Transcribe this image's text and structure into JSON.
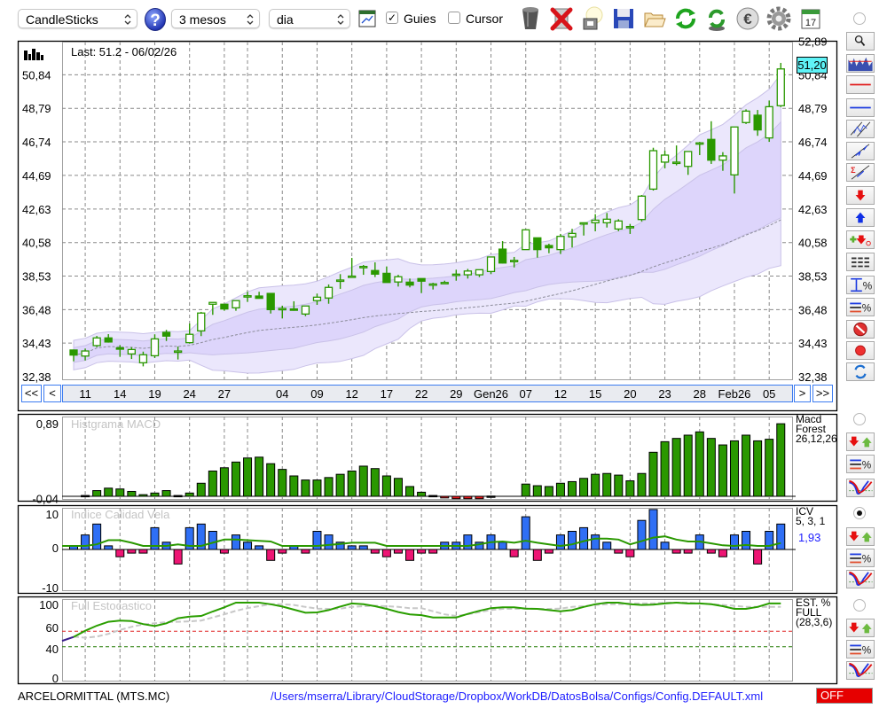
{
  "toolbar": {
    "chart_type": "CandleSticks",
    "period": "3 mesos",
    "interval": "dia",
    "guies_label": "Guies",
    "guies_checked": true,
    "cursor_label": "Cursor",
    "cursor_checked": false,
    "check_mark": "✓",
    "icons": [
      "help-icon",
      "chart-settings-icon",
      "trash-icon",
      "delete-icon",
      "lamp-icon",
      "save-icon",
      "folder-open-icon",
      "refresh-icon",
      "sync-icon",
      "euro-icon",
      "gear-icon",
      "calendar-icon"
    ],
    "calendar_day": "17"
  },
  "price_panel": {
    "last_label": "Last: 51.2 - 06/02/26",
    "last_price_badge": "51,20",
    "nav": {
      "first": "<<",
      "prev": "<",
      "next": ">",
      "last": ">>"
    }
  },
  "side_tools": [
    "zoom-icon",
    "chart-thumbnail-icon",
    "horizontal-red-line-icon",
    "horizontal-blue-line-icon",
    "channel-icon",
    "trendline-icon",
    "sigma-trendline-icon",
    "sell-arrow-icon",
    "buy-arrow-icon",
    "add-order-icon",
    "dashed-lines-icon",
    "percent-range-icon",
    "percent-lines-icon",
    "no-entry-icon",
    "record-icon",
    "swap-icon"
  ],
  "indicators": {
    "macd": {
      "label": "Macd\nForest\n26,12,26",
      "selected": false
    },
    "icv": {
      "label": "ICV\n5, 3, 1",
      "value": "1,93",
      "selected": true
    },
    "stoch": {
      "label": "EST. %\nFULL\n(28,3,6)",
      "selected": false
    }
  },
  "footer": {
    "symbol": "ARCELORMITTAL (MTS.MC)",
    "config_path": "/Users/mserra/Library/CloudStorage/Dropbox/WorkDB/DatosBolsa/Configs/Config.DEFAULT.xml",
    "status": "OFF"
  },
  "colors": {
    "candle": "#2a9800",
    "band_outer": "#ebe7fc",
    "band_inner": "#ddd5fb",
    "macd_pos": "#2a9800",
    "macd_neg": "#e8191c",
    "icv_pos": "#2f6ff5",
    "icv_neg": "#ee1574",
    "icv_signal": "#2a9800",
    "stoch_k": "#2a9e00",
    "stoch_d": "#c8c8c8",
    "badge": "#5ff3f7",
    "off": "#e60000",
    "path": "#1d1dff"
  },
  "chart_data": [
    {
      "type": "candlestick",
      "y_ticks": [
        32.38,
        34.43,
        36.48,
        38.53,
        40.58,
        42.63,
        44.69,
        46.74,
        48.79,
        50.84,
        52.89
      ],
      "ylim": [
        32.38,
        52.89
      ],
      "grid": true,
      "x_labels": [
        {
          "label": "11",
          "index": 1
        },
        {
          "label": "14",
          "index": 4
        },
        {
          "label": "19",
          "index": 7
        },
        {
          "label": "24",
          "index": 10
        },
        {
          "label": "27",
          "index": 13
        },
        {
          "label": "",
          "index": 15
        },
        {
          "label": "04",
          "index": 18
        },
        {
          "label": "09",
          "index": 21
        },
        {
          "label": "12",
          "index": 24
        },
        {
          "label": "17",
          "index": 27
        },
        {
          "label": "22",
          "index": 30
        },
        {
          "label": "29",
          "index": 33
        },
        {
          "label": "Gen26",
          "index": 36
        },
        {
          "label": "07",
          "index": 39
        },
        {
          "label": "12",
          "index": 42
        },
        {
          "label": "15",
          "index": 45
        },
        {
          "label": "20",
          "index": 48
        },
        {
          "label": "23",
          "index": 51
        },
        {
          "label": "28",
          "index": 54
        },
        {
          "label": "Feb26",
          "index": 57
        },
        {
          "label": "05",
          "index": 60
        }
      ],
      "ohlc": [
        [
          34.01,
          34.04,
          33.32,
          33.7
        ],
        [
          33.64,
          34.1,
          33.37,
          33.95
        ],
        [
          34.28,
          34.87,
          34.18,
          34.75
        ],
        [
          34.75,
          34.98,
          34.46,
          34.5
        ],
        [
          34.14,
          34.31,
          33.59,
          34.11
        ],
        [
          33.77,
          34.18,
          33.46,
          34.04
        ],
        [
          33.23,
          33.91,
          33.01,
          33.72
        ],
        [
          33.66,
          34.97,
          33.52,
          34.69
        ],
        [
          35.09,
          35.24,
          34.56,
          34.86
        ],
        [
          33.9,
          34.22,
          33.43,
          33.95
        ],
        [
          34.46,
          35.63,
          34.4,
          34.97
        ],
        [
          35.18,
          36.34,
          34.86,
          36.27
        ],
        [
          36.81,
          36.92,
          36.16,
          36.92
        ],
        [
          36.81,
          36.81,
          36.41,
          36.52
        ],
        [
          36.59,
          37.03,
          36.41,
          37.03
        ],
        [
          37.31,
          37.57,
          36.95,
          37.33
        ],
        [
          37.31,
          37.57,
          37.17,
          37.17
        ],
        [
          37.47,
          37.49,
          36.24,
          36.48
        ],
        [
          36.52,
          36.72,
          35.94,
          36.55
        ],
        [
          36.52,
          36.99,
          36.41,
          36.5
        ],
        [
          36.21,
          36.7,
          36.08,
          36.7
        ],
        [
          37.03,
          37.46,
          36.77,
          37.24
        ],
        [
          37.19,
          38.02,
          36.84,
          37.84
        ],
        [
          38.25,
          38.65,
          37.75,
          38.29
        ],
        [
          38.5,
          39.64,
          38.43,
          38.53
        ],
        [
          39.1,
          39.21,
          38.61,
          39.12
        ],
        [
          38.87,
          39.37,
          38.47,
          38.65
        ],
        [
          38.7,
          39.12,
          38.14,
          38.14
        ],
        [
          38.17,
          38.61,
          37.89,
          38.49
        ],
        [
          38.16,
          38.38,
          37.84,
          37.98
        ],
        [
          38.38,
          38.38,
          37.49,
          38.22
        ],
        [
          38.03,
          38.12,
          37.71,
          38.05
        ],
        [
          38.12,
          38.25,
          38.07,
          38.14
        ],
        [
          38.63,
          38.92,
          38.25,
          38.65
        ],
        [
          38.61,
          38.97,
          38.38,
          38.84
        ],
        [
          38.61,
          38.92,
          38.47,
          38.92
        ],
        [
          38.81,
          39.7,
          38.65,
          39.7
        ],
        [
          40.18,
          40.67,
          39.3,
          39.33
        ],
        [
          39.47,
          39.7,
          39.06,
          39.49
        ],
        [
          40.15,
          41.36,
          40.15,
          41.36
        ],
        [
          40.87,
          40.87,
          39.66,
          40.15
        ],
        [
          40.4,
          40.51,
          39.93,
          40.26
        ],
        [
          40.15,
          41.11,
          39.88,
          40.96
        ],
        [
          40.93,
          41.42,
          40.28,
          41.14
        ],
        [
          41.76,
          41.79,
          41.01,
          41.79
        ],
        [
          41.79,
          42.32,
          41.27,
          41.95
        ],
        [
          41.79,
          42.39,
          41.5,
          42.01
        ],
        [
          41.41,
          42.01,
          41.28,
          41.9
        ],
        [
          41.54,
          41.72,
          41.11,
          41.56
        ],
        [
          41.99,
          43.49,
          41.87,
          43.42
        ],
        [
          43.85,
          46.38,
          43.76,
          46.2
        ],
        [
          45.5,
          46.2,
          45.12,
          45.93
        ],
        [
          45.48,
          46.52,
          45.3,
          45.5
        ],
        [
          45.24,
          46.15,
          44.72,
          46.15
        ],
        [
          46.65,
          46.74,
          45.93,
          46.68
        ],
        [
          46.89,
          48.0,
          45.39,
          45.62
        ],
        [
          45.62,
          46.11,
          44.97,
          45.88
        ],
        [
          44.72,
          47.65,
          43.58,
          47.65
        ],
        [
          47.92,
          48.73,
          47.83,
          48.62
        ],
        [
          48.37,
          48.69,
          47.11,
          47.47
        ],
        [
          46.98,
          49.27,
          46.74,
          48.89
        ],
        [
          48.95,
          51.57,
          48.87,
          51.2
        ]
      ]
    },
    {
      "type": "bar",
      "title": "Histgrama MACD",
      "y_ticks": [
        0.89,
        -0.04
      ],
      "y_tick_labels": [
        "0,89",
        "-0,04"
      ],
      "values": [
        0,
        0.01,
        0.07,
        0.1,
        0.09,
        0.06,
        0.02,
        0.04,
        0.07,
        0.01,
        0.04,
        0.16,
        0.31,
        0.35,
        0.42,
        0.47,
        0.48,
        0.4,
        0.33,
        0.25,
        0.2,
        0.2,
        0.23,
        0.27,
        0.31,
        0.37,
        0.34,
        0.25,
        0.22,
        0.12,
        0.05,
        0.01,
        -0.02,
        -0.03,
        -0.03,
        -0.03,
        0.003,
        0,
        0,
        0.15,
        0.13,
        0.12,
        0.16,
        0.18,
        0.22,
        0.27,
        0.28,
        0.26,
        0.19,
        0.28,
        0.54,
        0.67,
        0.71,
        0.75,
        0.79,
        0.71,
        0.63,
        0.68,
        0.75,
        0.68,
        0.7,
        0.89
      ]
    },
    {
      "type": "bar",
      "title": "Indice Calidad Vela",
      "y_ticks": [
        10,
        0,
        -10
      ],
      "y_tick_labels": [
        "10",
        "0",
        "-10"
      ],
      "values": [
        1,
        4,
        7,
        1,
        -2,
        -1,
        -1,
        6,
        2,
        -4,
        6,
        7,
        5,
        -1,
        4,
        2,
        1,
        -3,
        -1,
        1,
        -1,
        5,
        4,
        2,
        1,
        1,
        -1,
        -2,
        -1,
        -3,
        -1,
        -1,
        2,
        2,
        4,
        2,
        4,
        2,
        -2,
        9,
        -3,
        -1,
        4,
        5,
        6,
        4,
        2,
        -1,
        -2,
        8,
        11,
        2,
        -1,
        -1,
        4,
        -1,
        -2,
        4,
        5,
        -4,
        5,
        7
      ],
      "signal": [
        1,
        1,
        1.5,
        2.8,
        2.8,
        2,
        1,
        1,
        1,
        1.5,
        1,
        1,
        2,
        3,
        3,
        2.8,
        2.6,
        2.4,
        1,
        1,
        1,
        1,
        1.3,
        1.6,
        2,
        2,
        2,
        1,
        1,
        1,
        1,
        1,
        1,
        1,
        1,
        1.5,
        2.2,
        2.4,
        2,
        2.6,
        2,
        1.5,
        1,
        1.5,
        2.5,
        3.3,
        3.3,
        3,
        1.5,
        2.5,
        3.6,
        4,
        3,
        2.4,
        2.4,
        1.8,
        1.2,
        1,
        1.3,
        1,
        1,
        1.93
      ]
    },
    {
      "type": "line",
      "title": "Full Estocastico",
      "y_ticks": [
        100,
        60,
        40,
        0
      ],
      "y_tick_labels": [
        "100",
        "60",
        "40",
        "0"
      ],
      "levels": [
        60,
        40
      ],
      "k": [
        56,
        64,
        70.5,
        75.5,
        77,
        76.5,
        72.5,
        70,
        73.5,
        80,
        82,
        83,
        88.6,
        94,
        100,
        100,
        100,
        98,
        95,
        91,
        87,
        87.5,
        90.5,
        95,
        99,
        98,
        95.5,
        92,
        88,
        85,
        84,
        81,
        81,
        81,
        85.6,
        89.5,
        93,
        94,
        94,
        92.4,
        92,
        90.5,
        89,
        90.5,
        94.5,
        98,
        100,
        100,
        98,
        97,
        97.5,
        99,
        100,
        99,
        99,
        98,
        95.5,
        92,
        92,
        94.5,
        99,
        99
      ],
      "d": [
        56.5,
        55,
        56.5,
        60,
        65,
        69,
        72,
        73.5,
        75,
        75.5,
        76,
        77,
        81,
        85,
        89.5,
        93,
        95.5,
        98,
        98,
        97,
        94.5,
        92.4,
        92,
        92.4,
        94.5,
        95.5,
        96,
        95.5,
        94.5,
        93,
        93,
        89,
        85,
        83,
        85,
        88,
        90.5,
        92,
        92,
        92.4,
        92,
        92,
        92.4,
        94.5,
        95.5,
        97,
        98,
        98,
        99,
        99,
        99,
        100,
        100,
        100,
        99,
        98,
        97,
        96,
        94.5,
        94.5,
        94.5,
        94.5
      ]
    }
  ]
}
